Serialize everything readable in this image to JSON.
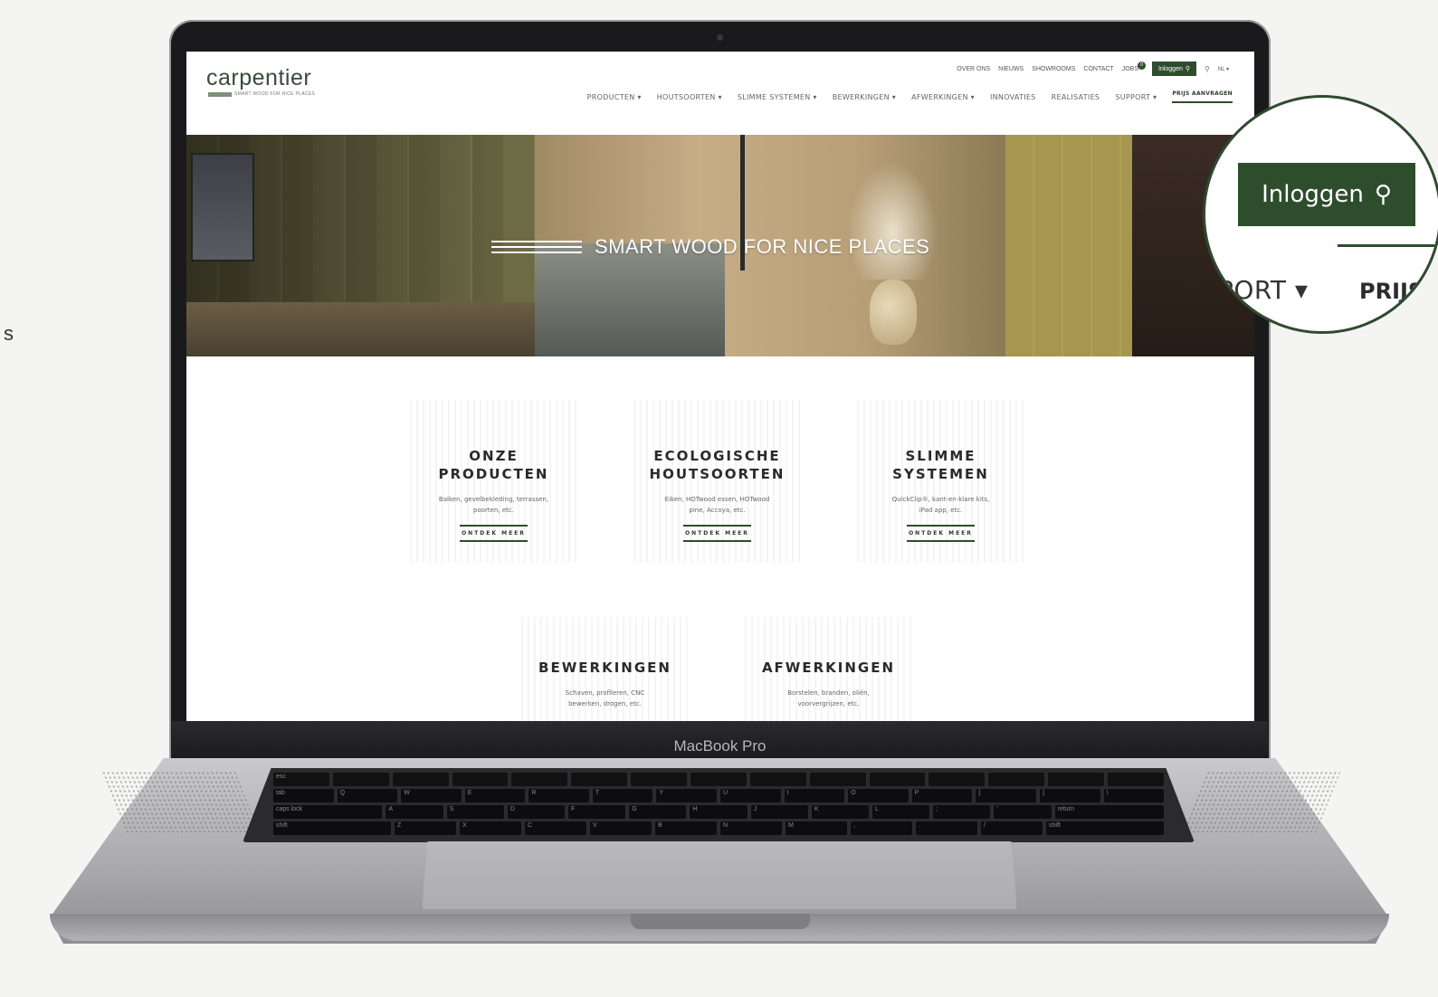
{
  "stray_text": "s",
  "device": {
    "label": "MacBook Pro"
  },
  "site": {
    "logo": {
      "wordmark": "carpentier",
      "tagline": "SMART WOOD FOR NICE PLACES"
    },
    "top_nav": {
      "items": [
        "OVER ONS",
        "NIEUWS",
        "SHOWROOMS",
        "CONTACT",
        "JOBS"
      ],
      "jobs_badge": "0",
      "login_label": "Inloggen",
      "language": "NL ▾"
    },
    "main_nav": {
      "items": [
        "PRODUCTEN ▾",
        "HOUTSOORTEN ▾",
        "SLIMME SYSTEMEN ▾",
        "BEWERKINGEN ▾",
        "AFWERKINGEN ▾",
        "INNOVATIES",
        "REALISATIES",
        "SUPPORT ▾"
      ],
      "quote_label": "PRIJS AANVRAGEN"
    },
    "hero": {
      "tagline": "SMART WOOD FOR NICE PLACES"
    },
    "cards": [
      {
        "title_1": "ONZE",
        "title_2": "PRODUCTEN",
        "desc_1": "Balken, gevelbekleding, terrassen,",
        "desc_2": "poorten, etc.",
        "cta": "ONTDEK MEER"
      },
      {
        "title_1": "ECOLOGISCHE",
        "title_2": "HOUTSOORTEN",
        "desc_1": "Eiken, HOTwood essen, HOTwood",
        "desc_2": "pine, Accoya, etc.",
        "cta": "ONTDEK MEER"
      },
      {
        "title_1": "SLIMME",
        "title_2": "SYSTEMEN",
        "desc_1": "QuickClip®, kant-en-klare kits,",
        "desc_2": "iPad app, etc.",
        "cta": "ONTDEK MEER"
      },
      {
        "title_1": "BEWERKINGEN",
        "desc_1": "Schaven, profileren, CNC",
        "desc_2": "bewerken, drogen, etc."
      },
      {
        "title_1": "AFWERKINGEN",
        "desc_1": "Borstelen, branden, oliën,",
        "desc_2": "voorvergrijzen, etc."
      }
    ]
  },
  "zoom": {
    "login_label": "Inloggen",
    "support_fragment": "PORT ▾",
    "quote_fragment": "PRIJS"
  },
  "keyboard": {
    "rows": [
      [
        "esc",
        "",
        "",
        "",
        "",
        "",
        "",
        "",
        "",
        "",
        "",
        "",
        "",
        "",
        ""
      ],
      [
        "~",
        "1",
        "2",
        "3",
        "4",
        "5",
        "6",
        "7",
        "8",
        "9",
        "0",
        "-",
        "=",
        "delete"
      ],
      [
        "tab",
        "Q",
        "W",
        "E",
        "R",
        "T",
        "Y",
        "U",
        "I",
        "O",
        "P",
        "[",
        "]",
        "\\"
      ],
      [
        "caps lock",
        "A",
        "S",
        "D",
        "F",
        "G",
        "H",
        "J",
        "K",
        "L",
        ";",
        "'",
        "return"
      ],
      [
        "shift",
        "Z",
        "X",
        "C",
        "V",
        "B",
        "N",
        "M",
        ",",
        ".",
        "/",
        "shift"
      ],
      [
        "fn",
        "control",
        "option",
        "command",
        "",
        "command",
        "option",
        "◀",
        "▲▼",
        "▶"
      ]
    ]
  },
  "colors": {
    "brand_green": "#2e4d2c"
  }
}
